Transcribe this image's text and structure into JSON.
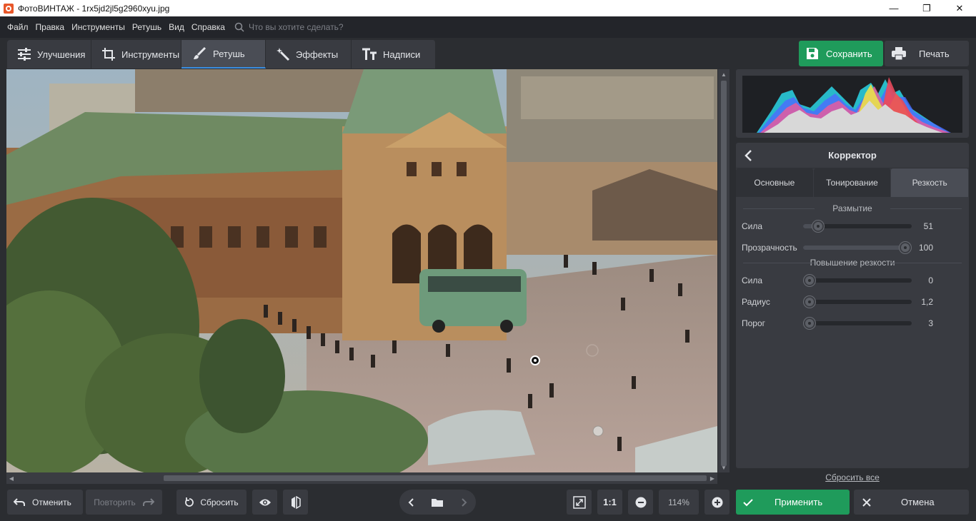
{
  "window": {
    "title": "ФотоВИНТАЖ - 1rx5jd2jl5g2960xyu.jpg",
    "controls": [
      "—",
      "❐",
      "✕"
    ]
  },
  "menu": {
    "items": [
      "Файл",
      "Правка",
      "Инструменты",
      "Ретушь",
      "Вид",
      "Справка"
    ],
    "search_placeholder": "Что вы хотите сделать?"
  },
  "toolbar": {
    "tabs": [
      {
        "label": "Улучшения",
        "icon": "sliders-icon"
      },
      {
        "label": "Инструменты",
        "icon": "crop-icon"
      },
      {
        "label": "Ретушь",
        "icon": "brush-icon",
        "active": true
      },
      {
        "label": "Эффекты",
        "icon": "magic-wand-icon"
      },
      {
        "label": "Надписи",
        "icon": "text-icon"
      }
    ],
    "save_label": "Сохранить",
    "print_label": "Печать"
  },
  "panel": {
    "title": "Корректор",
    "tabs": [
      "Основные",
      "Тонирование",
      "Резкость"
    ],
    "active_tab": "Резкость",
    "blur_section": "Размытие",
    "sharpen_section": "Повышение резкости",
    "sliders": [
      {
        "label": "Сила",
        "value": "51",
        "fraction": 0.14
      },
      {
        "label": "Прозрачность",
        "value": "100",
        "fraction": 0.94
      },
      {
        "label": "Сила",
        "value": "0",
        "fraction": 0.06
      },
      {
        "label": "Радиус",
        "value": "1,2",
        "fraction": 0.06
      },
      {
        "label": "Порог",
        "value": "3",
        "fraction": 0.06
      }
    ],
    "reset_all": "Сбросить все"
  },
  "bottom": {
    "undo": "Отменить",
    "redo": "Повторить",
    "reset": "Сбросить",
    "one_to_one": "1:1",
    "zoom": "114%",
    "apply": "Применить",
    "cancel": "Отмена"
  },
  "colors": {
    "accent_green": "#1f9b5b",
    "active_tab_underline": "#3a8de0",
    "panel_bg": "#393b41"
  }
}
